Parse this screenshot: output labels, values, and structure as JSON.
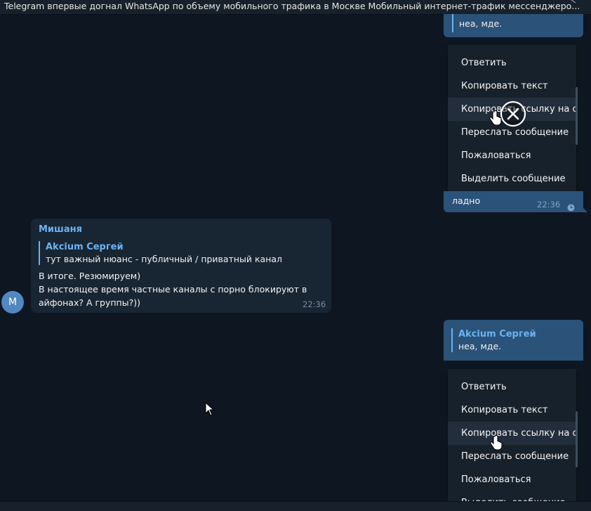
{
  "topbar": {
    "title": "Telegram впервые догнал WhatsApp по объему мобильного трафика в Москве  Мобильный интернет-трафик мессенджеро...",
    "icon": "collapse-icon"
  },
  "top_message": {
    "reply_text": "неа, мде.",
    "menu": [
      "Ответить",
      "Копировать текст",
      "Копировать ссылку на сообщение",
      "Переслать сообщение",
      "Пожаловаться",
      "Выделить сообщение"
    ],
    "text": "ладно",
    "time": "22:36",
    "status_icon": "clock-icon",
    "overlay_icon": "close-circle-icon"
  },
  "incoming": {
    "sender": "Мишаня",
    "reply_author": "Akcium Сергей",
    "reply_text": "тут важный нюанс - публичный / приватный канал",
    "lines": [
      "В итоге. Резюмируем)",
      "В настоящее время частные каналы с порно блокируют в",
      "айфонах? А группы?))"
    ],
    "time": "22:36",
    "avatar_letter": "M"
  },
  "bottom_message": {
    "reply_author": "Akcium Сергей",
    "reply_text": "неа, мде.",
    "menu": [
      "Ответить",
      "Копировать текст",
      "Копировать ссылку на сообщение",
      "Переслать сообщение",
      "Пожаловаться",
      "Выделить сообщение"
    ]
  },
  "colors": {
    "background": "#0e1621",
    "outgoing_bubble": "#2b5278",
    "incoming_bubble": "#182533",
    "accent": "#6ab3f3",
    "menu": "#17212b"
  }
}
